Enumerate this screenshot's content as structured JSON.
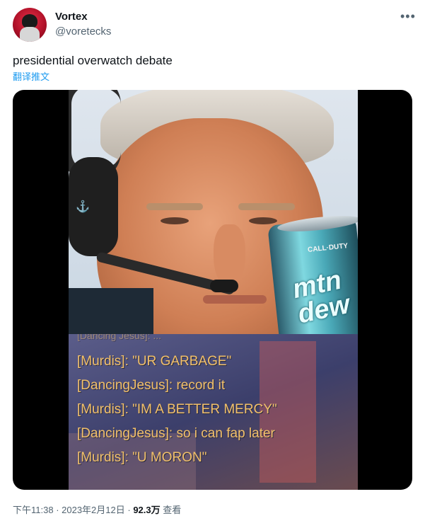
{
  "tweet": {
    "display_name": "Vortex",
    "handle": "@voretecks",
    "text": "presidential overwatch debate",
    "translate_label": "翻译推文",
    "more_icon": "more-icon"
  },
  "media": {
    "can_brand_top": "CALL·DUTY",
    "can_brand_main": "mtn dew",
    "chat_lines": [
      "[Dancing Jesus]: ...",
      "[Murdis]: \"UR GARBAGE\"",
      "[DancingJesus]: record it",
      "[Murdis]: \"IM A BETTER MERCY\"",
      "[DancingJesus]: so i can fap later",
      "[Murdis]: \"U MORON\""
    ]
  },
  "footer": {
    "time": "下午11:38",
    "sep1": " · ",
    "date": "2023年2月12日",
    "sep2": " · ",
    "views": "92.3万",
    "views_label": " 查看"
  }
}
